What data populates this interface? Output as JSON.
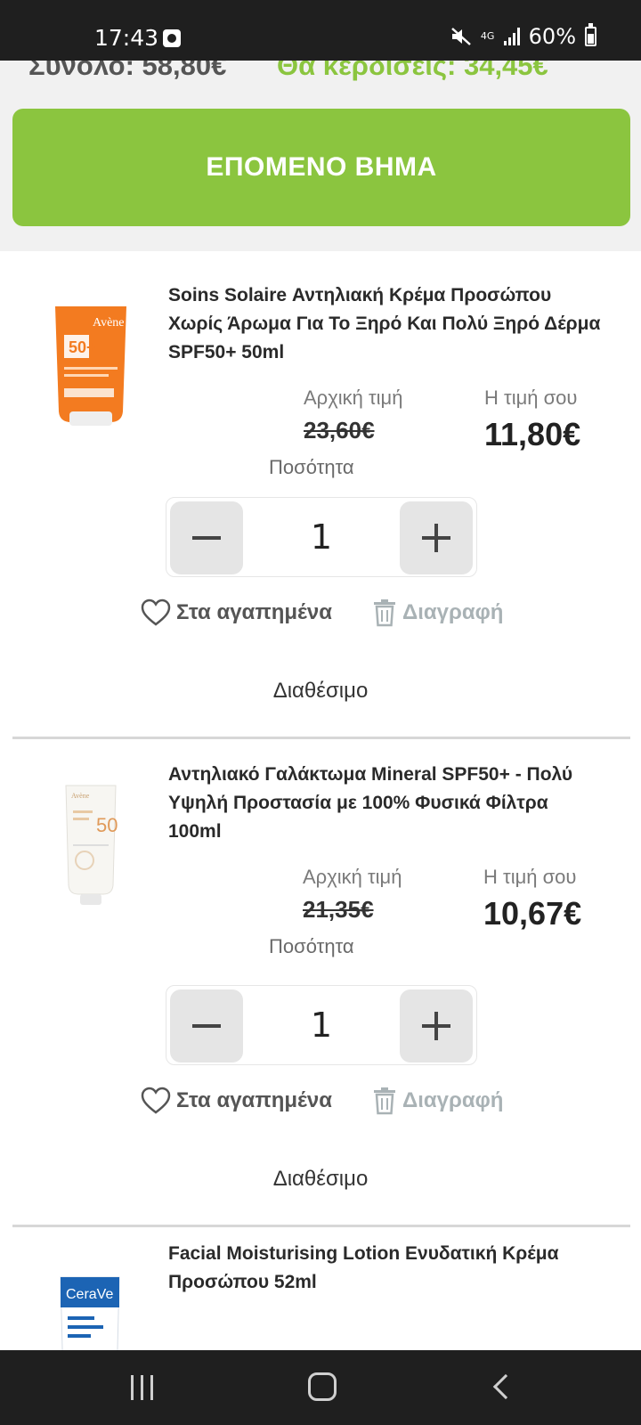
{
  "status_bar": {
    "time": "17:43",
    "network": "4G",
    "battery": "60%"
  },
  "summary": {
    "total_text": "Σύνολο: 58,80€",
    "save_text": "Θα κερδίσεις: 34,45€"
  },
  "cta": {
    "next_step_label": "ΕΠΟΜΕΝΟ ΒΗΜΑ",
    "color": "#8bc53f"
  },
  "labels": {
    "original_price": "Αρχική τιμή",
    "your_price": "Η τιμή σου",
    "quantity": "Ποσότητα",
    "favorites": "Στα αγαπημένα",
    "delete": "Διαγραφή",
    "available": "Διαθέσιμο"
  },
  "products": [
    {
      "title": "Soins Solaire Αντηλιακή Κρέμα Προσώπου Χωρίς Άρωμα Για Το Ξηρό Και Πολύ Ξηρό Δέρμα SPF50+ 50ml",
      "original_price": "23,60€",
      "price": "11,80€",
      "quantity": "1",
      "thumb_brand": "Avène",
      "thumb_text": "50+"
    },
    {
      "title": "Αντηλιακό Γαλάκτωμα Mineral SPF50+ - Πολύ Υψηλή Προστασία με 100% Φυσικά Φίλτρα 100ml",
      "original_price": "21,35€",
      "price": "10,67€",
      "quantity": "1",
      "thumb_brand": "Avène",
      "thumb_text": "50"
    },
    {
      "title": "Facial Moisturising Lotion Ενυδατική Κρέμα Προσώπου 52ml",
      "thumb_brand": "CeraVe"
    }
  ]
}
